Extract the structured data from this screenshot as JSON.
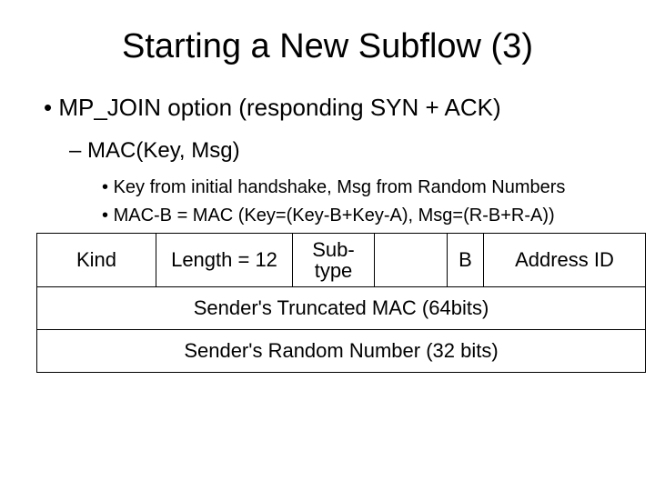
{
  "title": "Starting a New Subflow (3)",
  "bullets": {
    "l1": "MP_JOIN option (responding SYN + ACK)",
    "l2": "MAC(Key, Msg)",
    "l3a": "Key from initial handshake, Msg from Random Numbers",
    "l3b": "MAC-B = MAC (Key=(Key-B+Key-A), Msg=(R-B+R-A))"
  },
  "table": {
    "row1": {
      "kind": "Kind",
      "length": "Length = 12",
      "subtype": "Sub-type",
      "blank": "",
      "b": "B",
      "addrid": "Address ID"
    },
    "row2": "Sender's Truncated MAC (64bits)",
    "row3": "Sender's Random Number (32 bits)"
  }
}
